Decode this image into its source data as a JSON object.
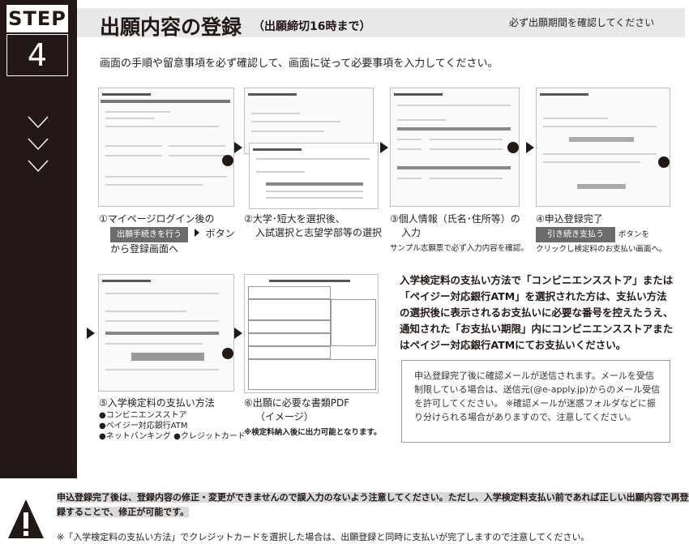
{
  "step": {
    "label": "STEP",
    "number": "4"
  },
  "header": {
    "title": "出願内容の登録",
    "deadline": "（出願締切16時まで）",
    "period_note": "必ず出願期間を確認してください"
  },
  "intro": "画面の手順や留意事項を必ず確認して、画面に従って必要事項を入力してください。",
  "steps": [
    {
      "line1": "①マイページログイン後の",
      "button": "出願手続きを行う",
      "after_button": "ボタン",
      "line3": "から登録画面へ"
    },
    {
      "line1": "②大学･短大を選択後、",
      "line2": "入試選択と志望学部等の選択"
    },
    {
      "line1": "③個人情報（氏名･住所等）の",
      "line2": "入力",
      "note": "サンプル志願票で必ず入力内容を確認。"
    },
    {
      "line1": "④申込登録完了",
      "button": "引き続き支払う",
      "after_button": "ボタンを",
      "line3": "クリックし検定料のお支払い画面へ。"
    },
    {
      "line1": "⑤入学検定料の支払い方法",
      "options": [
        "●コンビニエンスストア",
        "●ペイジー対応銀行ATM",
        "●ネットバンキング ●クレジットカード"
      ]
    },
    {
      "line1": "⑥出願に必要な書類PDF",
      "line2": "（イメージ）",
      "note": "※検定料納入後に出力可能となります。"
    }
  ],
  "pay_guidance": "入学検定料の支払い方法で「コンビニエンスストア」または「ペイジー対応銀行ATM」を選択された方は、支払い方法の選択後に表示されるお支払いに必要な番号を控えたうえ、通知された「お支払い期限」内にコンビニエンスストアまたはペイジー対応銀行ATMにてお支払いください。",
  "mail_box": "申込登録完了後に確認メールが送信されます。メールを受信制限している場合は、送信元(@e-apply.jp)からのメール受信を許可してください。 ※確認メールが迷惑フォルダなどに振り分けられる場合がありますので、注意してください。",
  "warning": {
    "part1": "申込登録完了後は、登録内容の修正・変更ができませんので誤入力のないよう注意してください。ただし、",
    "part2": "入学検定料支払い前であれば正しい出願内容で再登録することで、修正が可能です。",
    "note": "※「入学検定料の支払い方法」でクレジットカードを選択した場合は、出願登録と同時に支払いが完了しますので注意してください。"
  },
  "colors": {
    "dark": "#231815",
    "title_bar": "#e8e8e8",
    "highlight": "#d9d9d9"
  }
}
